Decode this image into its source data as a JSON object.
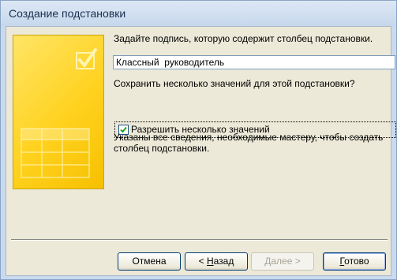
{
  "window": {
    "title": "Создание подстановки"
  },
  "wizard": {
    "caption_prompt": "Задайте подпись, которую содержит столбец подстановки.",
    "caption_value": "Классный  руководитель",
    "multi_prompt": "Сохранить несколько значений для этой подстановки?",
    "multi_checkbox_label": "Разрешить несколько значений",
    "multi_checked": true,
    "info_line1": "Указаны все сведения, необходимые мастеру, чтобы создать",
    "info_line2": "столбец подстановки."
  },
  "buttons": {
    "cancel": "Отмена",
    "back_prefix": "< ",
    "back_hotkey": "Н",
    "back_rest": "азад",
    "next_hotkey": "Д",
    "next_rest": "алее >",
    "finish_hotkey": "Г",
    "finish_rest": "отово"
  },
  "icons": {
    "wizard_image": "table-wizard-image-icon",
    "checkmark": "checkmark-icon"
  },
  "colors": {
    "accent_yellow": "#ffd21f",
    "window_frame": "#c9d9ee",
    "dialog_bg": "#ece9d8",
    "checkmark_green": "#21a121"
  }
}
